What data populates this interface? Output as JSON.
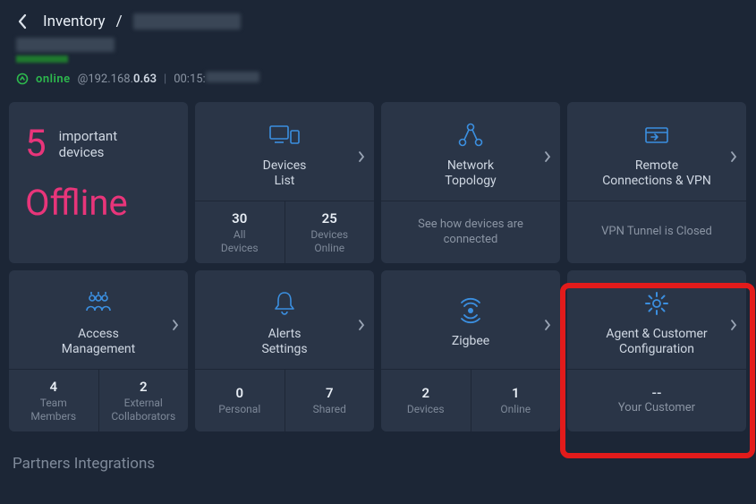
{
  "header": {
    "breadcrumb_root": "Inventory",
    "breadcrumb_sep": "/",
    "status_label": "online",
    "ip_prefix": "@192.168.",
    "ip_bold": "0.63",
    "mac_prefix": "00:15:"
  },
  "cards": {
    "offline": {
      "count": "5",
      "label_line1": "important",
      "label_line2": "devices",
      "big": "Offline"
    },
    "devices": {
      "title_line1": "Devices",
      "title_line2": "List",
      "stat1_num": "30",
      "stat1_lbl_line1": "All",
      "stat1_lbl_line2": "Devices",
      "stat2_num": "25",
      "stat2_lbl_line1": "Devices",
      "stat2_lbl_line2": "Online"
    },
    "topology": {
      "title_line1": "Network",
      "title_line2": "Topology",
      "subtitle_line1": "See how devices are",
      "subtitle_line2": "connected"
    },
    "remote": {
      "title_line1": "Remote",
      "title_line2": "Connections & VPN",
      "subtitle": "VPN Tunnel is Closed"
    },
    "access": {
      "title_line1": "Access",
      "title_line2": "Management",
      "stat1_num": "4",
      "stat1_lbl_line1": "Team",
      "stat1_lbl_line2": "Members",
      "stat2_num": "2",
      "stat2_lbl_line1": "External",
      "stat2_lbl_line2": "Collaborators"
    },
    "alerts": {
      "title_line1": "Alerts",
      "title_line2": "Settings",
      "stat1_num": "0",
      "stat1_lbl": "Personal",
      "stat2_num": "7",
      "stat2_lbl": "Shared"
    },
    "zigbee": {
      "title": "Zigbee",
      "stat1_num": "2",
      "stat1_lbl": "Devices",
      "stat2_num": "1",
      "stat2_lbl": "Online"
    },
    "agent": {
      "title_line1": "Agent & Customer",
      "title_line2": "Configuration",
      "sub_num": "--",
      "sub_lbl": "Your Customer"
    }
  },
  "section_title": "Partners Integrations",
  "colors": {
    "accent_blue": "#3b8fe0",
    "accent_pink": "#e8357a",
    "accent_green": "#2db84d",
    "highlight_red": "#e21b1b"
  }
}
